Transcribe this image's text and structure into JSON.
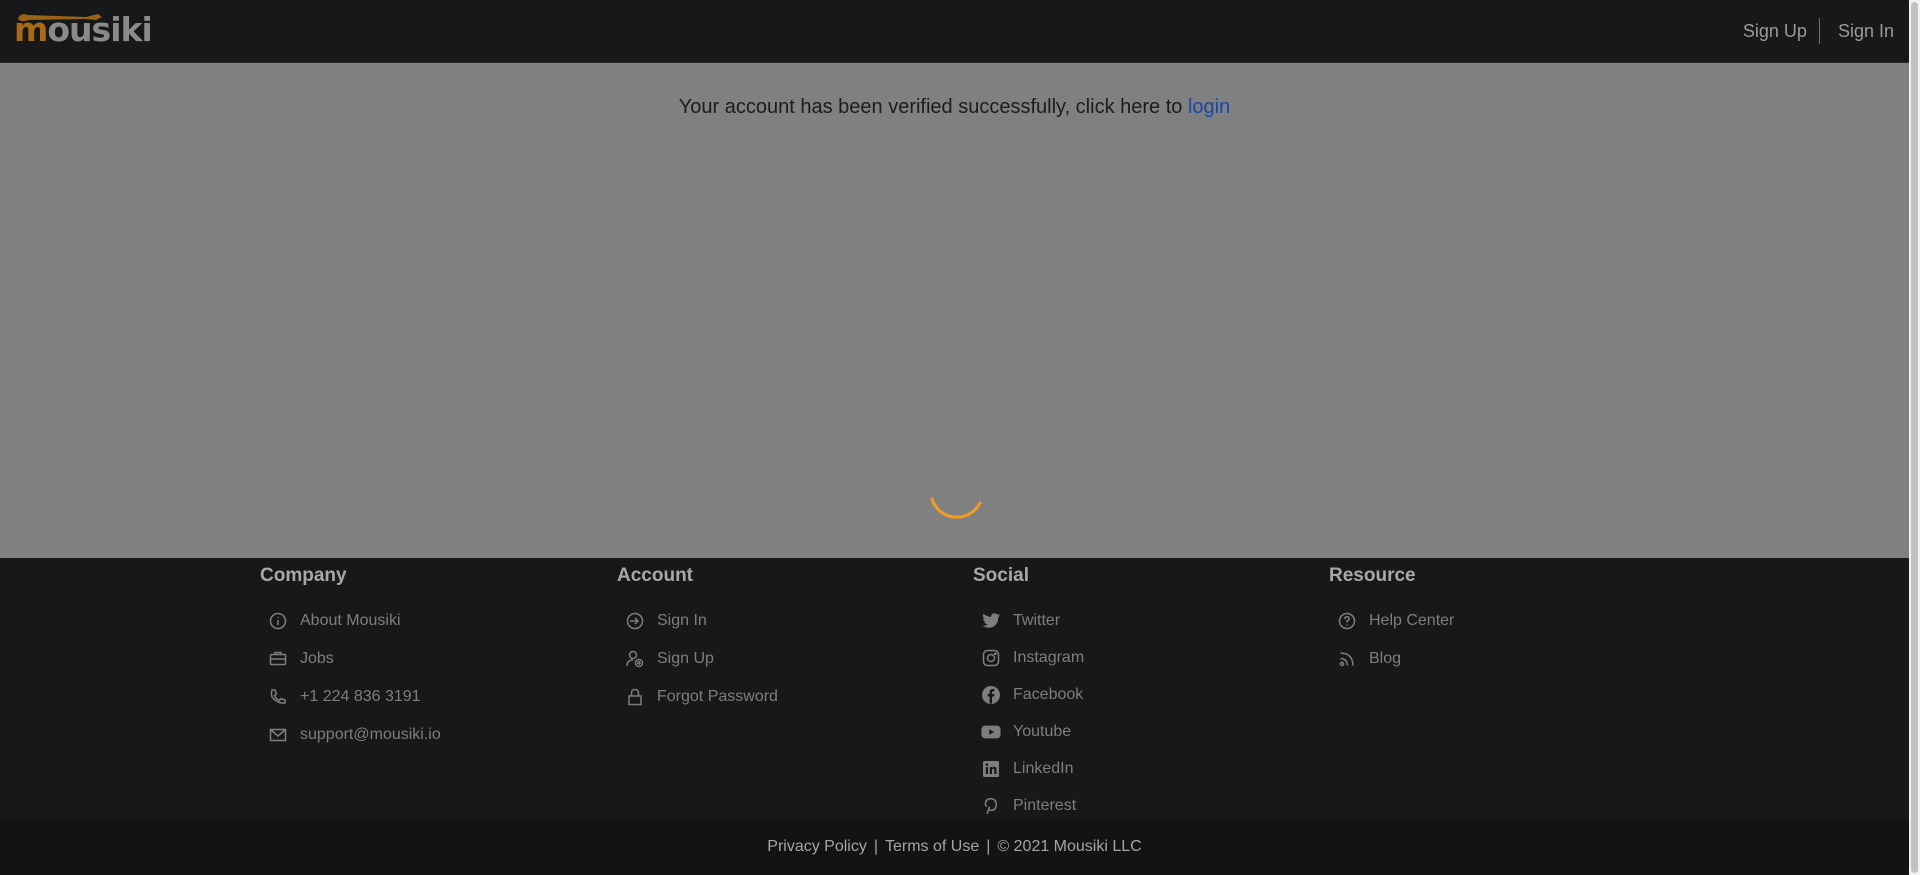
{
  "header": {
    "logo_first": "m",
    "logo_rest": "ousiki",
    "signup_label": "Sign Up",
    "signin_label": "Sign In"
  },
  "main": {
    "message": "Your account has been verified successfully, click here to ",
    "login_link": "login"
  },
  "footer": {
    "company": {
      "title": "Company",
      "items": [
        {
          "label": "About Mousiki",
          "icon": "info-icon"
        },
        {
          "label": "Jobs",
          "icon": "briefcase-icon"
        },
        {
          "label": "+1 224 836 3191",
          "icon": "phone-icon"
        },
        {
          "label": "support@mousiki.io",
          "icon": "mail-icon"
        }
      ]
    },
    "account": {
      "title": "Account",
      "items": [
        {
          "label": "Sign In",
          "icon": "login-icon"
        },
        {
          "label": "Sign Up",
          "icon": "user-add-icon"
        },
        {
          "label": "Forgot Password",
          "icon": "lock-icon"
        }
      ]
    },
    "social": {
      "title": "Social",
      "items": [
        {
          "label": "Twitter",
          "icon": "twitter-icon"
        },
        {
          "label": "Instagram",
          "icon": "instagram-icon"
        },
        {
          "label": "Facebook",
          "icon": "facebook-icon"
        },
        {
          "label": "Youtube",
          "icon": "youtube-icon"
        },
        {
          "label": "LinkedIn",
          "icon": "linkedin-icon"
        },
        {
          "label": "Pinterest",
          "icon": "pinterest-icon"
        }
      ]
    },
    "resource": {
      "title": "Resource",
      "items": [
        {
          "label": "Help Center",
          "icon": "help-circle-icon"
        },
        {
          "label": "Blog",
          "icon": "rss-icon"
        }
      ]
    }
  },
  "bottom": {
    "privacy": "Privacy Policy",
    "terms": "Terms of Use",
    "separator": "|",
    "copyright": "© 2021 Mousiki LLC"
  },
  "colors": {
    "header_bg": "#17181a",
    "overlay_bg": "#808080",
    "accent": "#f29d1f",
    "link": "#1847a8"
  }
}
